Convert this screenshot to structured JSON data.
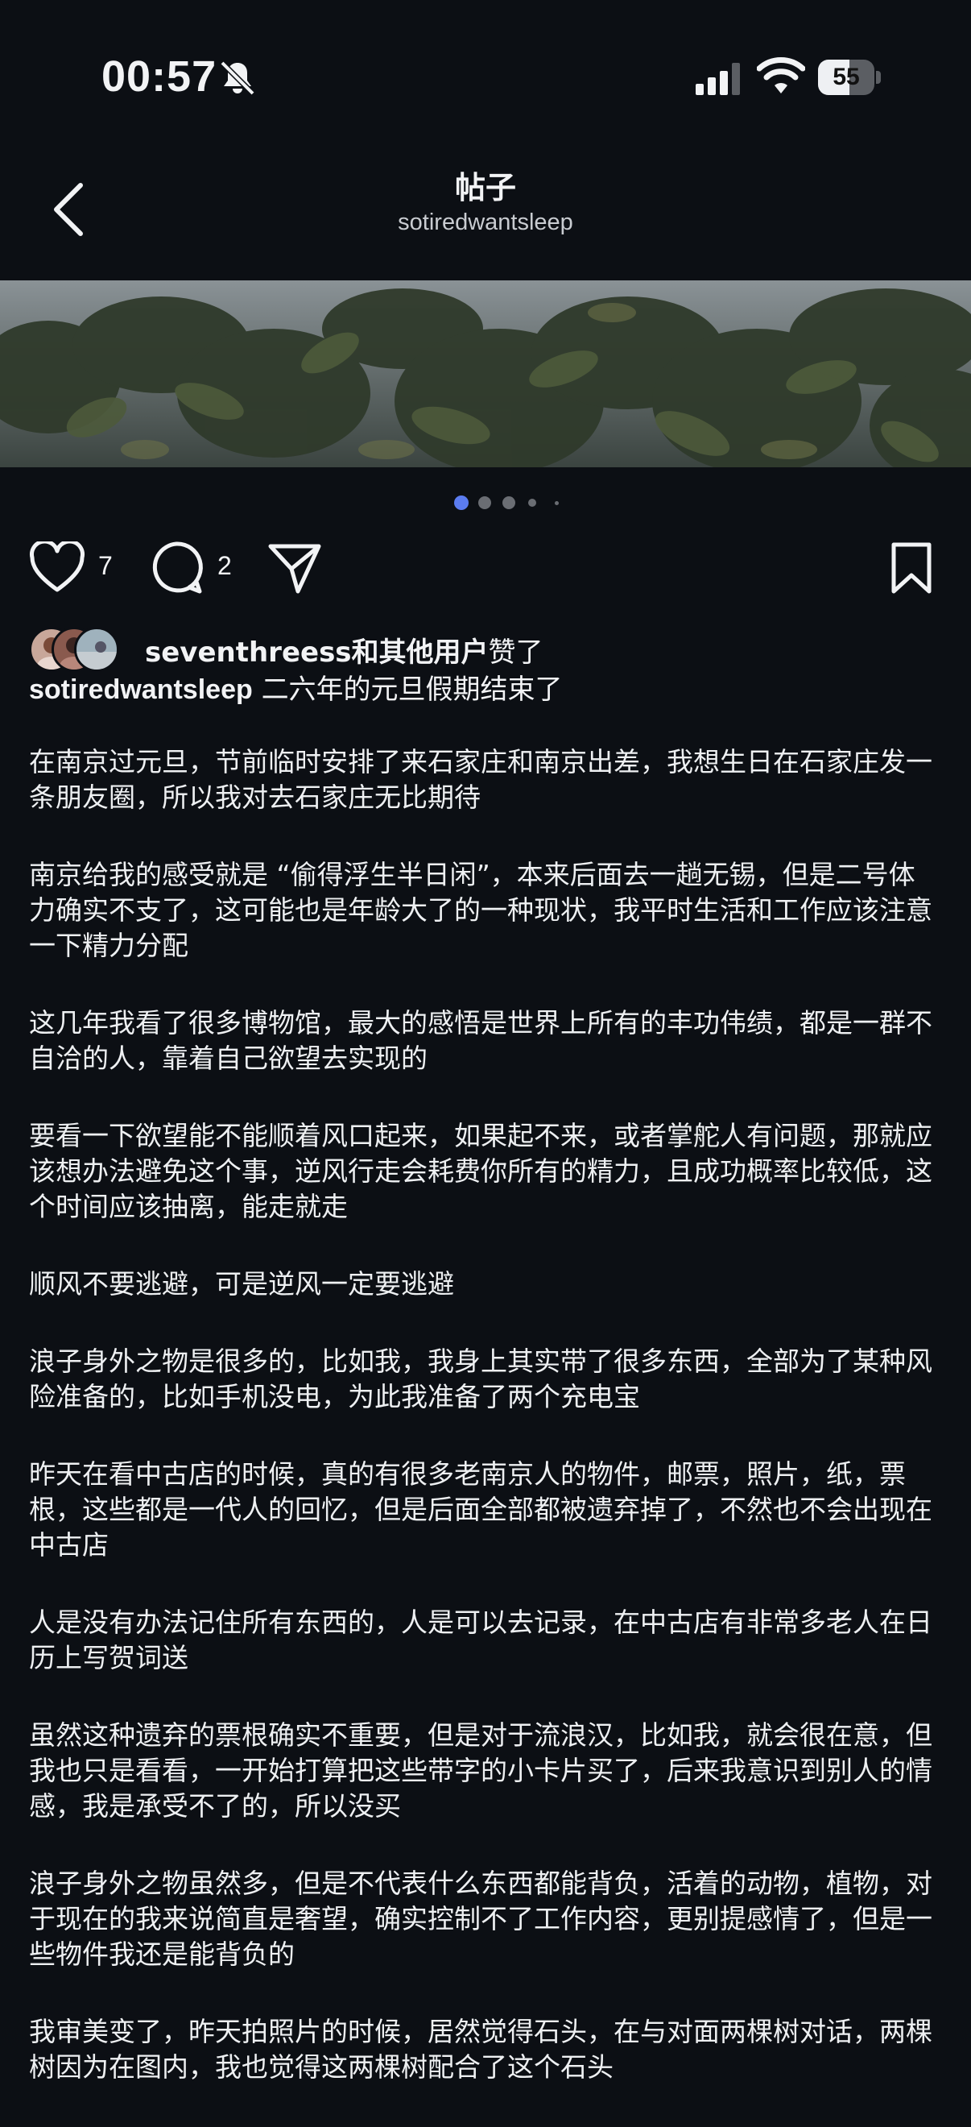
{
  "status": {
    "time": "00:57",
    "battery": "55",
    "battery_level": 0.55
  },
  "header": {
    "title": "帖子",
    "subtitle": "sotiredwantsleep"
  },
  "actions": {
    "like_count": "7",
    "comment_count": "2"
  },
  "carousel": {
    "pages": 5,
    "active_index": 0
  },
  "likes": {
    "user": "seventhreess",
    "suffix": "和其他用户",
    "verb": "赞了"
  },
  "caption": {
    "username": "sotiredwantsleep",
    "text": "二六年的元旦假期结束了"
  },
  "paragraphs": [
    "在南京过元旦，节前临时安排了来石家庄和南京出差，我想生日在石家庄发一条朋友圈，所以我对去石家庄无比期待",
    "南京给我的感受就是 “偷得浮生半日闲”，本来后面去一趟无锡，但是二号体力确实不支了，这可能也是年龄大了的一种现状，我平时生活和工作应该注意一下精力分配",
    "这几年我看了很多博物馆，最大的感悟是世界上所有的丰功伟绩，都是一群不自洽的人，靠着自己欲望去实现的",
    "要看一下欲望能不能顺着风口起来，如果起不来，或者掌舵人有问题，那就应该想办法避免这个事，逆风行走会耗费你所有的精力，且成功概率比较低，这个时间应该抽离，能走就走",
    "顺风不要逃避，可是逆风一定要逃避",
    "浪子身外之物是很多的，比如我，我身上其实带了很多东西，全部为了某种风险准备的，比如手机没电，为此我准备了两个充电宝",
    "昨天在看中古店的时候，真的有很多老南京人的物件，邮票，照片，纸，票根，这些都是一代人的回忆，但是后面全部都被遗弃掉了，不然也不会出现在中古店",
    "人是没有办法记住所有东西的，人是可以去记录，在中古店有非常多老人在日历上写贺词送",
    "虽然这种遗弃的票根确实不重要，但是对于流浪汉，比如我，就会很在意，但我也只是看看，一开始打算把这些带字的小卡片买了，后来我意识到别人的情感，我是承受不了的，所以没买",
    "浪子身外之物虽然多，但是不代表什么东西都能背负，活着的动物，植物，对于现在的我来说简直是奢望，确实控制不了工作内容，更别提感情了，但是一些物件我还是能背负的",
    "我审美变了，昨天拍照片的时候，居然觉得石头，在与对面两棵树对话，两棵树因为在图内，我也觉得这两棵树配合了这个石头"
  ],
  "colors": {
    "background": "#0c0f14",
    "text": "#f2f3f5",
    "active_dot": "#5b7cf0"
  }
}
